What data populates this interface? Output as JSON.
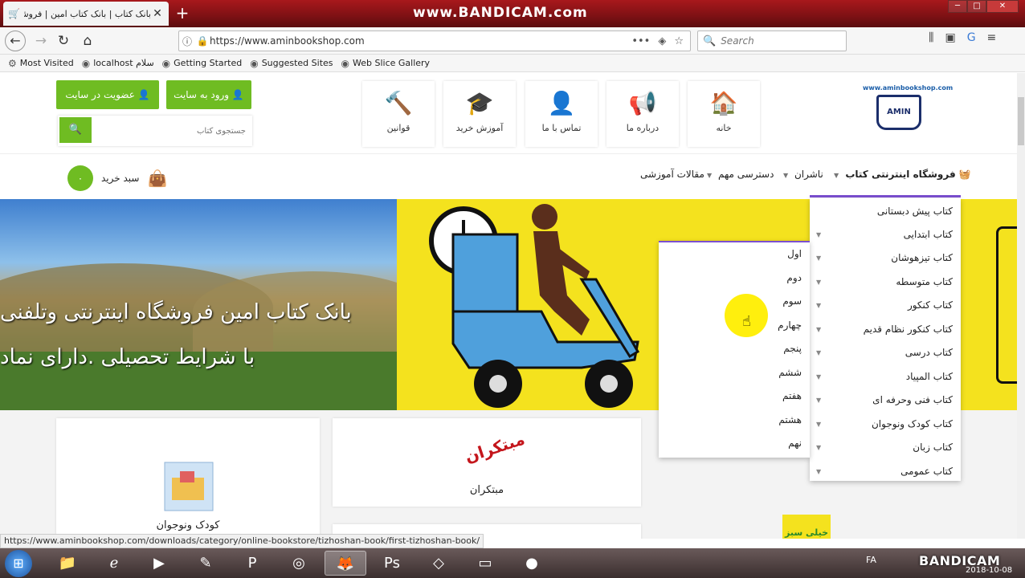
{
  "browser": {
    "tab_title": "بانک کتاب | بانک کتاب امین | فروشگ",
    "watermark": "www.BANDICAM.com",
    "url": "https://www.aminbookshop.com",
    "search_placeholder": "Search",
    "bookmarks": [
      {
        "label": "Most Visited"
      },
      {
        "label": "localhost سلام"
      },
      {
        "label": "Getting Started"
      },
      {
        "label": "Suggested Sites"
      },
      {
        "label": "Web Slice Gallery"
      }
    ],
    "status_url": "https://www.aminbookshop.com/downloads/category/online-bookstore/tizhoshan-book/first-tizhoshan-book/"
  },
  "header": {
    "logo_text": "www.aminbookshop.com",
    "logo_brand": "AMIN",
    "top_nav": [
      {
        "label": "خانه",
        "icon": "🏠"
      },
      {
        "label": "درباره ما",
        "icon": "📢"
      },
      {
        "label": "تماس با ما",
        "icon": "👤"
      },
      {
        "label": "آموزش خرید",
        "icon": "🎓"
      },
      {
        "label": "قوانین",
        "icon": "🔨"
      }
    ],
    "login_button": "ورود به سایت",
    "register_button": "عضویت در سایت",
    "search_placeholder": "جستجوی کتاب"
  },
  "menu": {
    "items": [
      "فروشگاه اینترنتی کتاب",
      "ناشران",
      "دسترسی مهم",
      "مقالات آموزشی"
    ],
    "cart_label": "سبد خرید",
    "cart_count": "۰"
  },
  "banner": {
    "line1": "بانک کتاب امین فروشگاه اینترنتی وتلفنی",
    "line2": "با شرایط تحصیلی .دارای نماد"
  },
  "dropdown": {
    "items": [
      "کتاب پیش دبستانی",
      "کتاب ابتدایی",
      "کتاب تیزهوشان",
      "کتاب متوسطه",
      "کتاب کنکور",
      "کتاب کنکور نظام قدیم",
      "کتاب درسی",
      "کتاب المپیاد",
      "کتاب فنی وحرفه ای",
      "کتاب کودک ونوجوان",
      "کتاب زبان",
      "کتاب عمومی"
    ],
    "sub_items": [
      "اول",
      "دوم",
      "سوم",
      "چهارم",
      "پنجم",
      "ششم",
      "هفتم",
      "هشتم",
      "نهم"
    ]
  },
  "cards": {
    "card1_label": "کودک ونوجوان",
    "card2_label": "مبتکران",
    "card2_logo": "مبتکران",
    "card3_logo": "خیلی سبز"
  },
  "taskbar": {
    "lang": "FA",
    "bandicam": "BANDICAM",
    "date": "2018-10-08"
  }
}
